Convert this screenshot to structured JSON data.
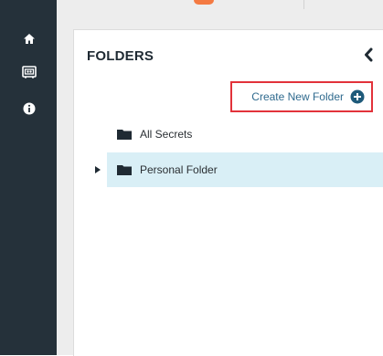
{
  "nav": {
    "items": [
      {
        "icon": "home-icon"
      },
      {
        "icon": "vault-icon"
      },
      {
        "icon": "info-icon"
      }
    ]
  },
  "panel": {
    "title": "FOLDERS",
    "collapse_icon": "chevron-left-icon",
    "create_label": "Create New Folder",
    "create_icon": "plus-circle-icon"
  },
  "folders": [
    {
      "label": "All Secrets",
      "icon": "folder-icon",
      "selected": false,
      "expandable": false
    },
    {
      "label": "Personal Folder",
      "icon": "folder-icon",
      "selected": true,
      "expandable": true
    }
  ],
  "colors": {
    "nav_bg": "#25313a",
    "highlight_border": "#e2323a",
    "link": "#2f6a8e",
    "selected_row": "#d9eff6",
    "accent": "#f47a42"
  }
}
